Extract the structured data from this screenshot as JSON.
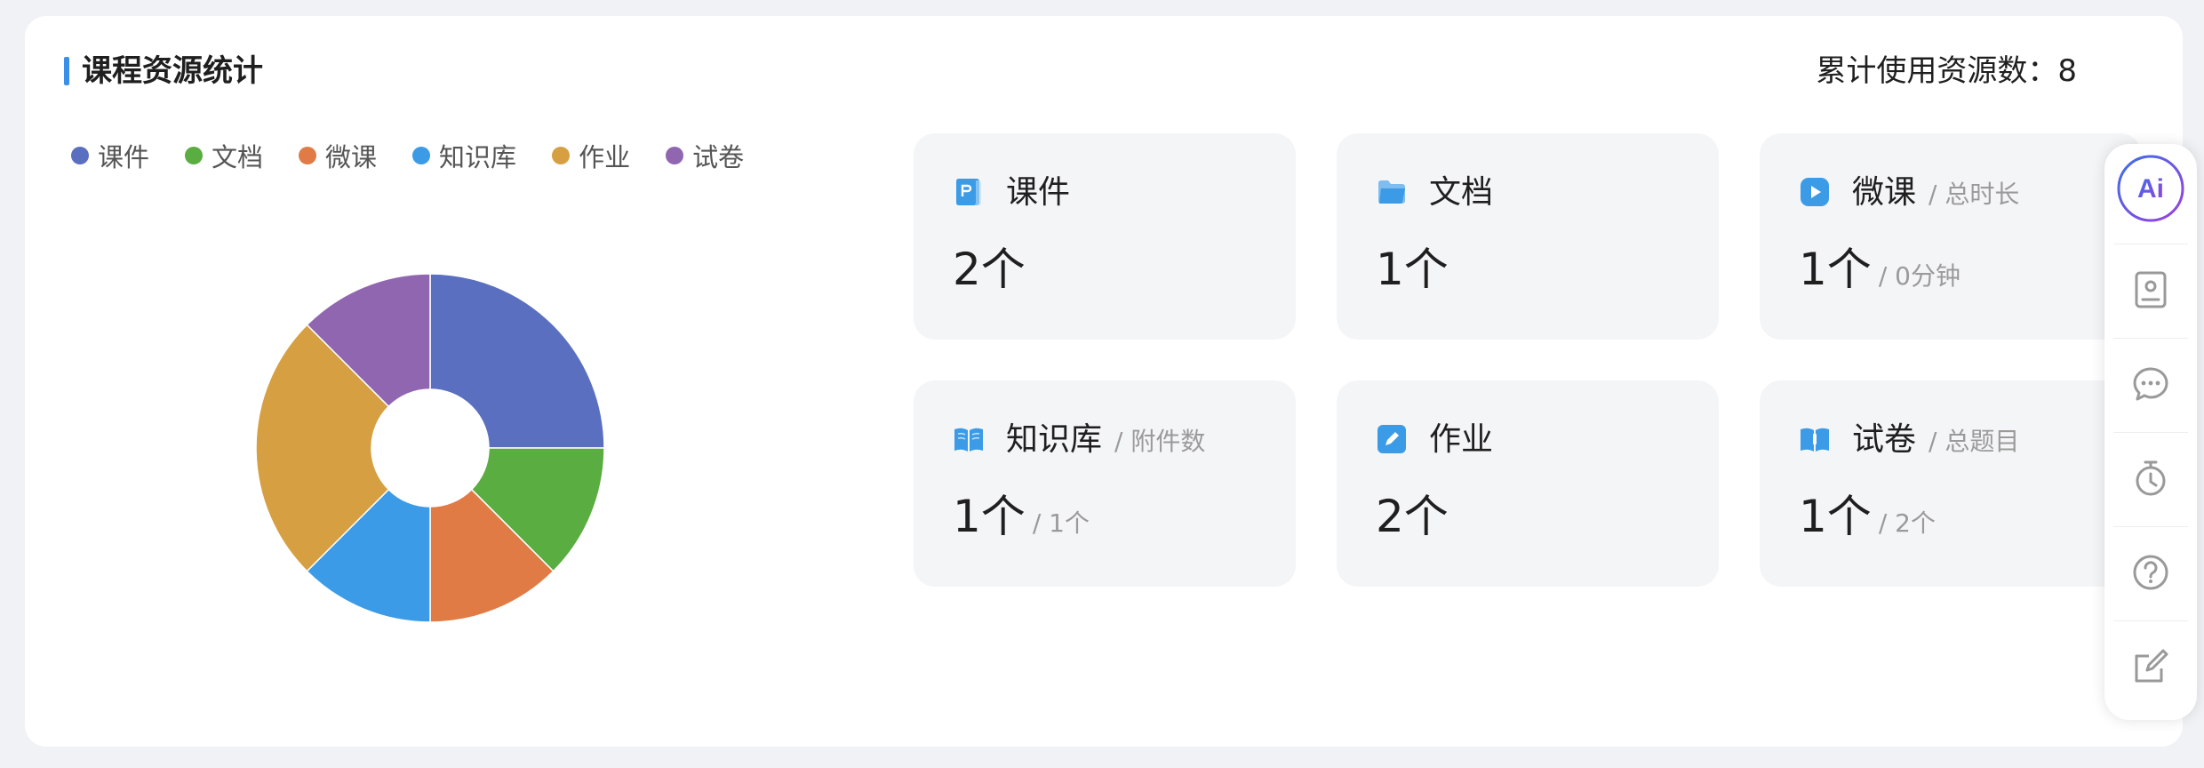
{
  "header": {
    "title": "课程资源统计",
    "total_label": "累计使用资源数：8"
  },
  "legend": [
    {
      "label": "课件",
      "color": "#5a6fc0"
    },
    {
      "label": "文档",
      "color": "#5aad40"
    },
    {
      "label": "微课",
      "color": "#e07b45"
    },
    {
      "label": "知识库",
      "color": "#3c9be6"
    },
    {
      "label": "作业",
      "color": "#d6a042"
    },
    {
      "label": "试卷",
      "color": "#9166b0"
    }
  ],
  "chart_data": {
    "type": "pie",
    "categories": [
      "课件",
      "文档",
      "微课",
      "知识库",
      "作业",
      "试卷"
    ],
    "values": [
      2,
      1,
      1,
      1,
      2,
      1
    ],
    "colors": [
      "#5a6fc0",
      "#5aad40",
      "#e07b45",
      "#3c9be6",
      "#d6a042",
      "#9166b0"
    ],
    "donut": true
  },
  "cards": [
    {
      "name": "课件",
      "sub": "",
      "count": "2个",
      "count_sub": "",
      "icon": "courseware-icon",
      "color": "#3c9be6"
    },
    {
      "name": "文档",
      "sub": "",
      "count": "1个",
      "count_sub": "",
      "icon": "folder-icon",
      "color": "#3c9be6"
    },
    {
      "name": "微课",
      "sub": "/ 总时长",
      "count": "1个",
      "count_sub": "/ 0分钟",
      "icon": "play-icon",
      "color": "#3c9be6"
    },
    {
      "name": "知识库",
      "sub": "/ 附件数",
      "count": "1个",
      "count_sub": "/ 1个",
      "icon": "book-icon",
      "color": "#3c9be6"
    },
    {
      "name": "作业",
      "sub": "",
      "count": "2个",
      "count_sub": "",
      "icon": "edit-icon",
      "color": "#3c9be6"
    },
    {
      "name": "试卷",
      "sub": "/ 总题目",
      "count": "1个",
      "count_sub": "/ 2个",
      "icon": "exam-icon",
      "color": "#3c9be6"
    }
  ],
  "sidebar": {
    "items": [
      {
        "icon": "ai-icon",
        "label": "Ai"
      },
      {
        "icon": "contact-card-icon"
      },
      {
        "icon": "chat-icon"
      },
      {
        "icon": "timer-icon"
      },
      {
        "icon": "help-icon"
      },
      {
        "icon": "edit-note-icon"
      }
    ]
  }
}
